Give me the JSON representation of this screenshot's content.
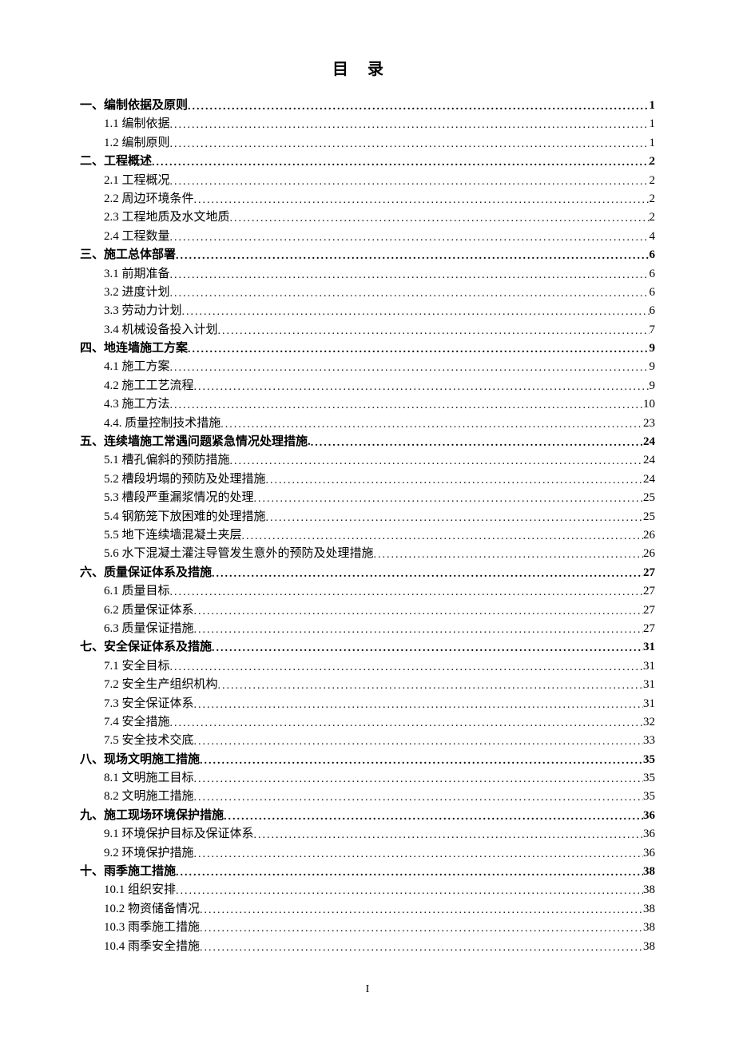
{
  "title": "目录",
  "pageNumber": "I",
  "entries": [
    {
      "level": 1,
      "label": "一、编制依据及原则",
      "page": "1"
    },
    {
      "level": 2,
      "label": "1.1 编制依据",
      "page": "1"
    },
    {
      "level": 2,
      "label": "1.2 编制原则",
      "page": "1"
    },
    {
      "level": 1,
      "label": "二、工程概述",
      "page": "2"
    },
    {
      "level": 2,
      "label": "2.1 工程概况",
      "page": "2"
    },
    {
      "level": 2,
      "label": "2.2 周边环境条件",
      "page": "2"
    },
    {
      "level": 2,
      "label": "2.3 工程地质及水文地质",
      "page": "2"
    },
    {
      "level": 2,
      "label": "2.4 工程数量",
      "page": "4"
    },
    {
      "level": 1,
      "label": "三、施工总体部署",
      "page": "6"
    },
    {
      "level": 2,
      "label": "3.1 前期准备",
      "page": "6"
    },
    {
      "level": 2,
      "label": "3.2 进度计划",
      "page": "6"
    },
    {
      "level": 2,
      "label": "3.3 劳动力计划",
      "page": "6"
    },
    {
      "level": 2,
      "label": "3.4 机械设备投入计划",
      "page": "7"
    },
    {
      "level": 1,
      "label": "四、地连墙施工方案",
      "page": "9"
    },
    {
      "level": 2,
      "label": "4.1 施工方案",
      "page": "9"
    },
    {
      "level": 2,
      "label": "4.2 施工工艺流程",
      "page": "9"
    },
    {
      "level": 2,
      "label": "4.3 施工方法",
      "page": "10"
    },
    {
      "level": 2,
      "label": "4.4. 质量控制技术措施",
      "page": "23"
    },
    {
      "level": 1,
      "label": "五、连续墙施工常遇问题紧急情况处理措施.",
      "page": "24"
    },
    {
      "level": 2,
      "label": "5.1 槽孔偏斜的预防措施",
      "page": "24"
    },
    {
      "level": 2,
      "label": "5.2 槽段坍塌的预防及处理措施",
      "page": "24"
    },
    {
      "level": 2,
      "label": "5.3 槽段严重漏浆情况的处理",
      "page": "25"
    },
    {
      "level": 2,
      "label": "5.4 钢筋笼下放困难的处理措施",
      "page": "25"
    },
    {
      "level": 2,
      "label": "5.5 地下连续墙混凝土夹层",
      "page": "26"
    },
    {
      "level": 2,
      "label": "5.6 水下混凝土灌注导管发生意外的预防及处理措施",
      "page": "26"
    },
    {
      "level": 1,
      "label": "六、质量保证体系及措施",
      "page": "27"
    },
    {
      "level": 2,
      "label": "6.1 质量目标",
      "page": "27"
    },
    {
      "level": 2,
      "label": "6.2 质量保证体系",
      "page": "27"
    },
    {
      "level": 2,
      "label": "6.3 质量保证措施",
      "page": "27"
    },
    {
      "level": 1,
      "label": "七、安全保证体系及措施",
      "page": "31"
    },
    {
      "level": 2,
      "label": "7.1 安全目标",
      "page": "31"
    },
    {
      "level": 2,
      "label": "7.2 安全生产组织机构",
      "page": "31"
    },
    {
      "level": 2,
      "label": "7.3 安全保证体系",
      "page": "31"
    },
    {
      "level": 2,
      "label": "7.4 安全措施",
      "page": "32"
    },
    {
      "level": 2,
      "label": "7.5 安全技术交底",
      "page": "33"
    },
    {
      "level": 1,
      "label": "八、现场文明施工措施",
      "page": "35"
    },
    {
      "level": 2,
      "label": "8.1 文明施工目标",
      "page": "35"
    },
    {
      "level": 2,
      "label": "8.2 文明施工措施",
      "page": "35"
    },
    {
      "level": 1,
      "label": "九、施工现场环境保护措施",
      "page": "36"
    },
    {
      "level": 2,
      "label": "9.1 环境保护目标及保证体系",
      "page": "36"
    },
    {
      "level": 2,
      "label": "9.2 环境保护措施",
      "page": "36"
    },
    {
      "level": 1,
      "label": "十、雨季施工措施",
      "page": "38"
    },
    {
      "level": 2,
      "label": "10.1 组织安排",
      "page": "38"
    },
    {
      "level": 2,
      "label": "10.2 物资储备情况",
      "page": "38"
    },
    {
      "level": 2,
      "label": "10.3 雨季施工措施",
      "page": "38"
    },
    {
      "level": 2,
      "label": "10.4 雨季安全措施",
      "page": "38"
    }
  ]
}
